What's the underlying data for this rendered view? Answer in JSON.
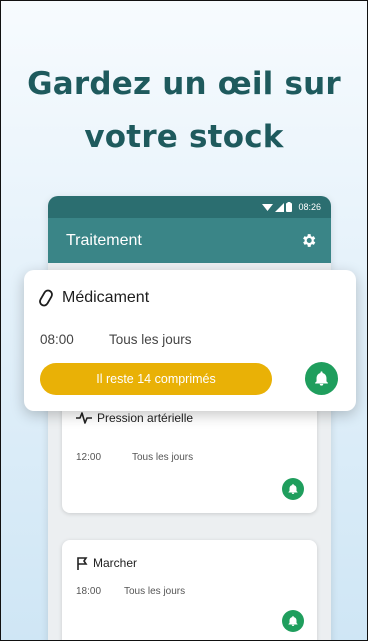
{
  "headline": {
    "line1": "Gardez un œil sur",
    "line2": "votre stock"
  },
  "status_bar": {
    "time": "08:26",
    "icons": [
      "wifi-icon",
      "signal-icon",
      "battery-icon"
    ]
  },
  "app_bar": {
    "title": "Traitement",
    "settings_icon": "gear-icon"
  },
  "featured_card": {
    "icon": "pill-icon",
    "title": "Médicament",
    "time": "08:00",
    "frequency": "Tous les jours",
    "stock_label": "Il reste 14 comprimés",
    "reminder_icon": "bell-icon"
  },
  "cards": [
    {
      "icon": "heartbeat-icon",
      "title": "Pression artérielle",
      "time": "12:00",
      "frequency": "Tous les jours",
      "reminder_icon": "bell-icon"
    },
    {
      "icon": "flag-icon",
      "title": "Marcher",
      "time": "18:00",
      "frequency": "Tous les jours",
      "reminder_icon": "bell-icon"
    }
  ],
  "colors": {
    "headline": "#1e5a5d",
    "status_bar": "#2b6e70",
    "app_bar": "#3a8587",
    "stock_pill": "#e9b106",
    "bell": "#1f9e5d"
  }
}
